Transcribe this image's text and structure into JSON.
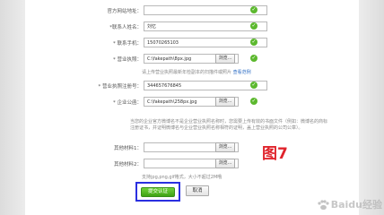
{
  "form": {
    "website": {
      "label": "官方网站地址：",
      "value": ""
    },
    "contact_name": {
      "label": "*联系人姓名：",
      "value": "刘忆"
    },
    "phone": {
      "label": "* 联系手机：",
      "value": "15070265103"
    },
    "license": {
      "label": "* 营业执照：",
      "value": "C:\\fakepath\\8px.jpg",
      "browse": "浏览..."
    },
    "license_hint": {
      "text": "请上传营业执照最新年检副本的扫描件或照片 ",
      "link": "查看范例"
    },
    "reg_no": {
      "label": "* 营业执照注册号：",
      "value": "344657676845"
    },
    "seal": {
      "label": "* 企业公函：",
      "value": "C:\\fakepath\\258px.jpg",
      "browse": "浏览..."
    },
    "notice": "当您的企业官方微博名不是企业营业执照名称时，您需要上传有效的书面文件（例如：微博名的商标注册证书，并证明微博名与企业营业执照名称相符的证明，盖上营业执照的公司公章）。",
    "other1": {
      "label": "其他材料1：",
      "value": "",
      "browse": "浏览..."
    },
    "other2": {
      "label": "其他材料2：",
      "value": "",
      "browse": "浏览..."
    },
    "file_hint": "支持jpg,png,gif格式，大小不超过2M哦",
    "submit_label": "提交认证",
    "cancel_label": "取消"
  },
  "annotation": "图7",
  "watermark": "Baidu经验"
}
